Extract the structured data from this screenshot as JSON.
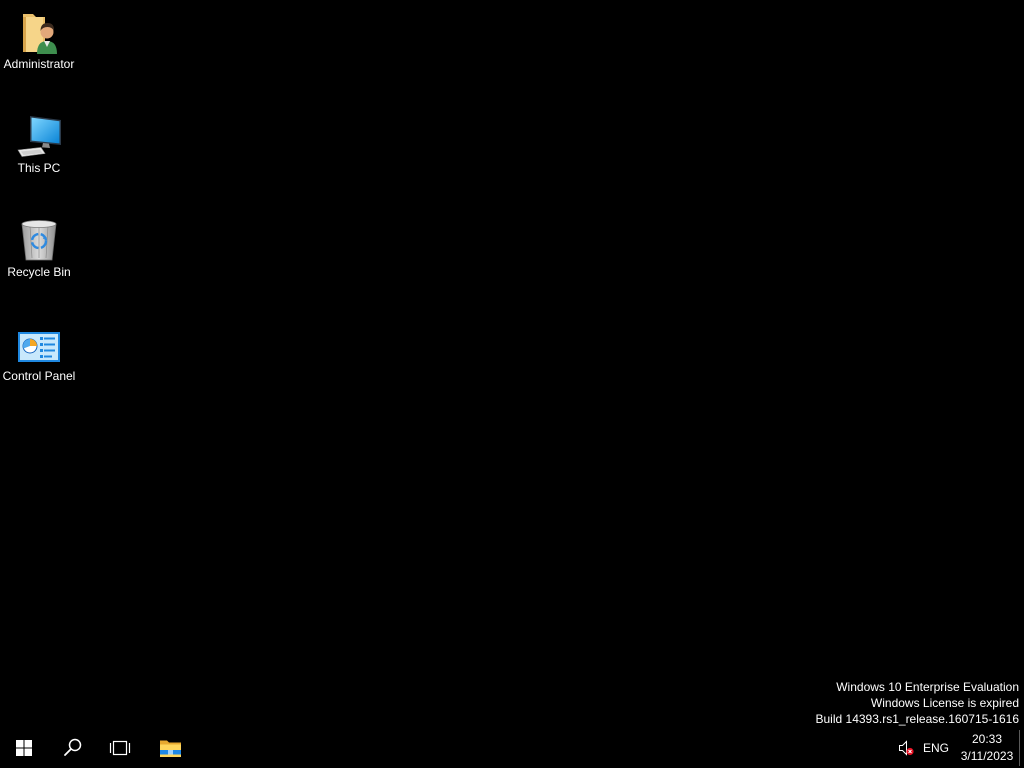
{
  "desktop": {
    "background_color": "#000000",
    "icons": [
      {
        "label": "Administrator",
        "icon": "user-folder-icon"
      },
      {
        "label": "This PC",
        "icon": "this-pc-icon"
      },
      {
        "label": "Recycle Bin",
        "icon": "recycle-bin-icon"
      },
      {
        "label": "Control Panel",
        "icon": "control-panel-icon"
      }
    ],
    "watermark": [
      "Windows 10 Enterprise Evaluation",
      "Windows License is expired",
      "Build 14393.rs1_release.160715-1616"
    ]
  },
  "taskbar": {
    "background_color": "#000000",
    "buttons": [
      {
        "icon": "windows-start-icon"
      },
      {
        "icon": "search-icon"
      },
      {
        "icon": "task-view-icon"
      },
      {
        "icon": "file-explorer-icon"
      }
    ],
    "tray": {
      "volume_icon": "volume-muted-icon",
      "language": "ENG",
      "time": "20:33",
      "date": "3/11/2023"
    }
  }
}
